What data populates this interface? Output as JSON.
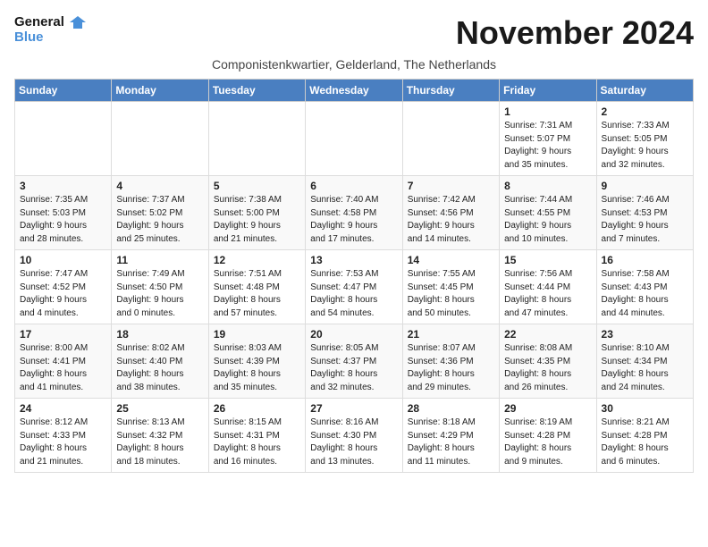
{
  "logo": {
    "line1": "General",
    "line2": "Blue"
  },
  "title": "November 2024",
  "subtitle": "Componistenkwartier, Gelderland, The Netherlands",
  "days_of_week": [
    "Sunday",
    "Monday",
    "Tuesday",
    "Wednesday",
    "Thursday",
    "Friday",
    "Saturday"
  ],
  "weeks": [
    [
      {
        "day": "",
        "info": ""
      },
      {
        "day": "",
        "info": ""
      },
      {
        "day": "",
        "info": ""
      },
      {
        "day": "",
        "info": ""
      },
      {
        "day": "",
        "info": ""
      },
      {
        "day": "1",
        "info": "Sunrise: 7:31 AM\nSunset: 5:07 PM\nDaylight: 9 hours\nand 35 minutes."
      },
      {
        "day": "2",
        "info": "Sunrise: 7:33 AM\nSunset: 5:05 PM\nDaylight: 9 hours\nand 32 minutes."
      }
    ],
    [
      {
        "day": "3",
        "info": "Sunrise: 7:35 AM\nSunset: 5:03 PM\nDaylight: 9 hours\nand 28 minutes."
      },
      {
        "day": "4",
        "info": "Sunrise: 7:37 AM\nSunset: 5:02 PM\nDaylight: 9 hours\nand 25 minutes."
      },
      {
        "day": "5",
        "info": "Sunrise: 7:38 AM\nSunset: 5:00 PM\nDaylight: 9 hours\nand 21 minutes."
      },
      {
        "day": "6",
        "info": "Sunrise: 7:40 AM\nSunset: 4:58 PM\nDaylight: 9 hours\nand 17 minutes."
      },
      {
        "day": "7",
        "info": "Sunrise: 7:42 AM\nSunset: 4:56 PM\nDaylight: 9 hours\nand 14 minutes."
      },
      {
        "day": "8",
        "info": "Sunrise: 7:44 AM\nSunset: 4:55 PM\nDaylight: 9 hours\nand 10 minutes."
      },
      {
        "day": "9",
        "info": "Sunrise: 7:46 AM\nSunset: 4:53 PM\nDaylight: 9 hours\nand 7 minutes."
      }
    ],
    [
      {
        "day": "10",
        "info": "Sunrise: 7:47 AM\nSunset: 4:52 PM\nDaylight: 9 hours\nand 4 minutes."
      },
      {
        "day": "11",
        "info": "Sunrise: 7:49 AM\nSunset: 4:50 PM\nDaylight: 9 hours\nand 0 minutes."
      },
      {
        "day": "12",
        "info": "Sunrise: 7:51 AM\nSunset: 4:48 PM\nDaylight: 8 hours\nand 57 minutes."
      },
      {
        "day": "13",
        "info": "Sunrise: 7:53 AM\nSunset: 4:47 PM\nDaylight: 8 hours\nand 54 minutes."
      },
      {
        "day": "14",
        "info": "Sunrise: 7:55 AM\nSunset: 4:45 PM\nDaylight: 8 hours\nand 50 minutes."
      },
      {
        "day": "15",
        "info": "Sunrise: 7:56 AM\nSunset: 4:44 PM\nDaylight: 8 hours\nand 47 minutes."
      },
      {
        "day": "16",
        "info": "Sunrise: 7:58 AM\nSunset: 4:43 PM\nDaylight: 8 hours\nand 44 minutes."
      }
    ],
    [
      {
        "day": "17",
        "info": "Sunrise: 8:00 AM\nSunset: 4:41 PM\nDaylight: 8 hours\nand 41 minutes."
      },
      {
        "day": "18",
        "info": "Sunrise: 8:02 AM\nSunset: 4:40 PM\nDaylight: 8 hours\nand 38 minutes."
      },
      {
        "day": "19",
        "info": "Sunrise: 8:03 AM\nSunset: 4:39 PM\nDaylight: 8 hours\nand 35 minutes."
      },
      {
        "day": "20",
        "info": "Sunrise: 8:05 AM\nSunset: 4:37 PM\nDaylight: 8 hours\nand 32 minutes."
      },
      {
        "day": "21",
        "info": "Sunrise: 8:07 AM\nSunset: 4:36 PM\nDaylight: 8 hours\nand 29 minutes."
      },
      {
        "day": "22",
        "info": "Sunrise: 8:08 AM\nSunset: 4:35 PM\nDaylight: 8 hours\nand 26 minutes."
      },
      {
        "day": "23",
        "info": "Sunrise: 8:10 AM\nSunset: 4:34 PM\nDaylight: 8 hours\nand 24 minutes."
      }
    ],
    [
      {
        "day": "24",
        "info": "Sunrise: 8:12 AM\nSunset: 4:33 PM\nDaylight: 8 hours\nand 21 minutes."
      },
      {
        "day": "25",
        "info": "Sunrise: 8:13 AM\nSunset: 4:32 PM\nDaylight: 8 hours\nand 18 minutes."
      },
      {
        "day": "26",
        "info": "Sunrise: 8:15 AM\nSunset: 4:31 PM\nDaylight: 8 hours\nand 16 minutes."
      },
      {
        "day": "27",
        "info": "Sunrise: 8:16 AM\nSunset: 4:30 PM\nDaylight: 8 hours\nand 13 minutes."
      },
      {
        "day": "28",
        "info": "Sunrise: 8:18 AM\nSunset: 4:29 PM\nDaylight: 8 hours\nand 11 minutes."
      },
      {
        "day": "29",
        "info": "Sunrise: 8:19 AM\nSunset: 4:28 PM\nDaylight: 8 hours\nand 9 minutes."
      },
      {
        "day": "30",
        "info": "Sunrise: 8:21 AM\nSunset: 4:28 PM\nDaylight: 8 hours\nand 6 minutes."
      }
    ]
  ]
}
